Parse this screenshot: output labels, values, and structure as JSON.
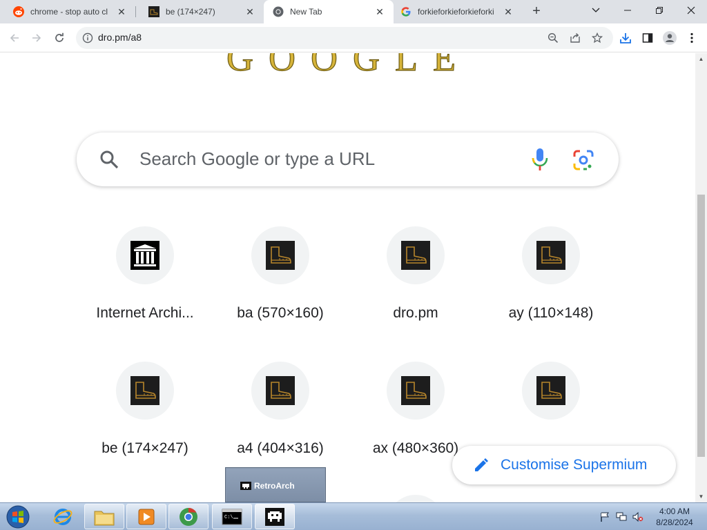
{
  "tabs": [
    {
      "label": "chrome - stop auto cl",
      "icon": "reddit-icon",
      "active": false
    },
    {
      "label": "be (174×247)",
      "icon": "boot-image-icon",
      "active": false
    },
    {
      "label": "New Tab",
      "icon": "chrome-icon",
      "active": true
    },
    {
      "label": "forkieforkieforkieforki",
      "icon": "google-icon",
      "active": false
    }
  ],
  "toolbar": {
    "url": "dro.pm/a8"
  },
  "doodle": {
    "text": "GOOGLE"
  },
  "search": {
    "placeholder": "Search Google or type a URL"
  },
  "shortcuts": [
    {
      "title": "Internet Archi...",
      "icon": "internet-archive-icon"
    },
    {
      "title": "ba (570×160)",
      "icon": "boot-image-icon"
    },
    {
      "title": "dro.pm",
      "icon": "boot-image-icon"
    },
    {
      "title": "ay (110×148)",
      "icon": "boot-image-icon"
    },
    {
      "title": "be (174×247)",
      "icon": "boot-image-icon"
    },
    {
      "title": "a4 (404×316)",
      "icon": "boot-image-icon"
    },
    {
      "title": "ax (480×360)",
      "icon": "boot-image-icon"
    },
    {
      "title": "",
      "icon": "boot-image-icon"
    }
  ],
  "customise": {
    "label": "Customise Supermium"
  },
  "retroarch_popup": {
    "label": "RetroArch"
  },
  "taskbar": {
    "apps": [
      "internet-explorer",
      "file-explorer",
      "media-player",
      "chrome",
      "command-prompt",
      "retroarch"
    ]
  },
  "clock": {
    "time": "4:00 AM",
    "date": "8/28/2024"
  },
  "colors": {
    "tabstrip": "#dee1e6",
    "accent": "#1a73e8",
    "doodle_gold": "#c9a227"
  }
}
